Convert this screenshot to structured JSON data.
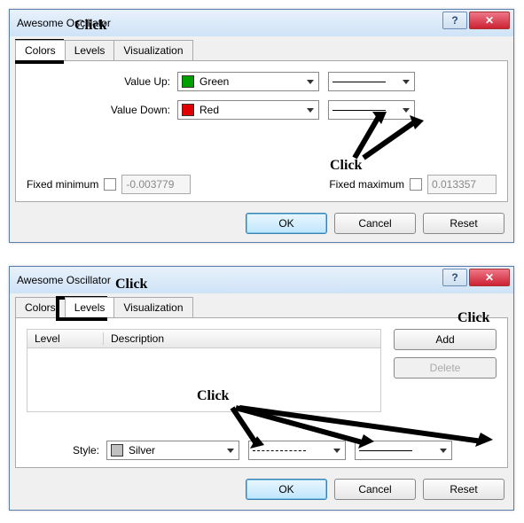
{
  "win1": {
    "title": "Awesome Oscillator",
    "tabs": {
      "colors": "Colors",
      "levels": "Levels",
      "viz": "Visualization"
    },
    "value_up_label": "Value Up:",
    "value_up_color": "Green",
    "value_up_hex": "#00a000",
    "value_down_label": "Value Down:",
    "value_down_color": "Red",
    "value_down_hex": "#e00000",
    "fixed_min_label": "Fixed minimum",
    "fixed_min_value": "-0.003779",
    "fixed_max_label": "Fixed maximum",
    "fixed_max_value": "0.013357",
    "ok": "OK",
    "cancel": "Cancel",
    "reset": "Reset"
  },
  "win2": {
    "title": "Awesome Oscillator",
    "tabs": {
      "colors": "Colors",
      "levels": "Levels",
      "viz": "Visualization"
    },
    "col_level": "Level",
    "col_desc": "Description",
    "add": "Add",
    "delete": "Delete",
    "style_label": "Style:",
    "style_color": "Silver",
    "style_hex": "#c0c0c0",
    "ok": "OK",
    "cancel": "Cancel",
    "reset": "Reset"
  },
  "ann": {
    "click": "Click"
  },
  "help": "?",
  "close": "✕"
}
